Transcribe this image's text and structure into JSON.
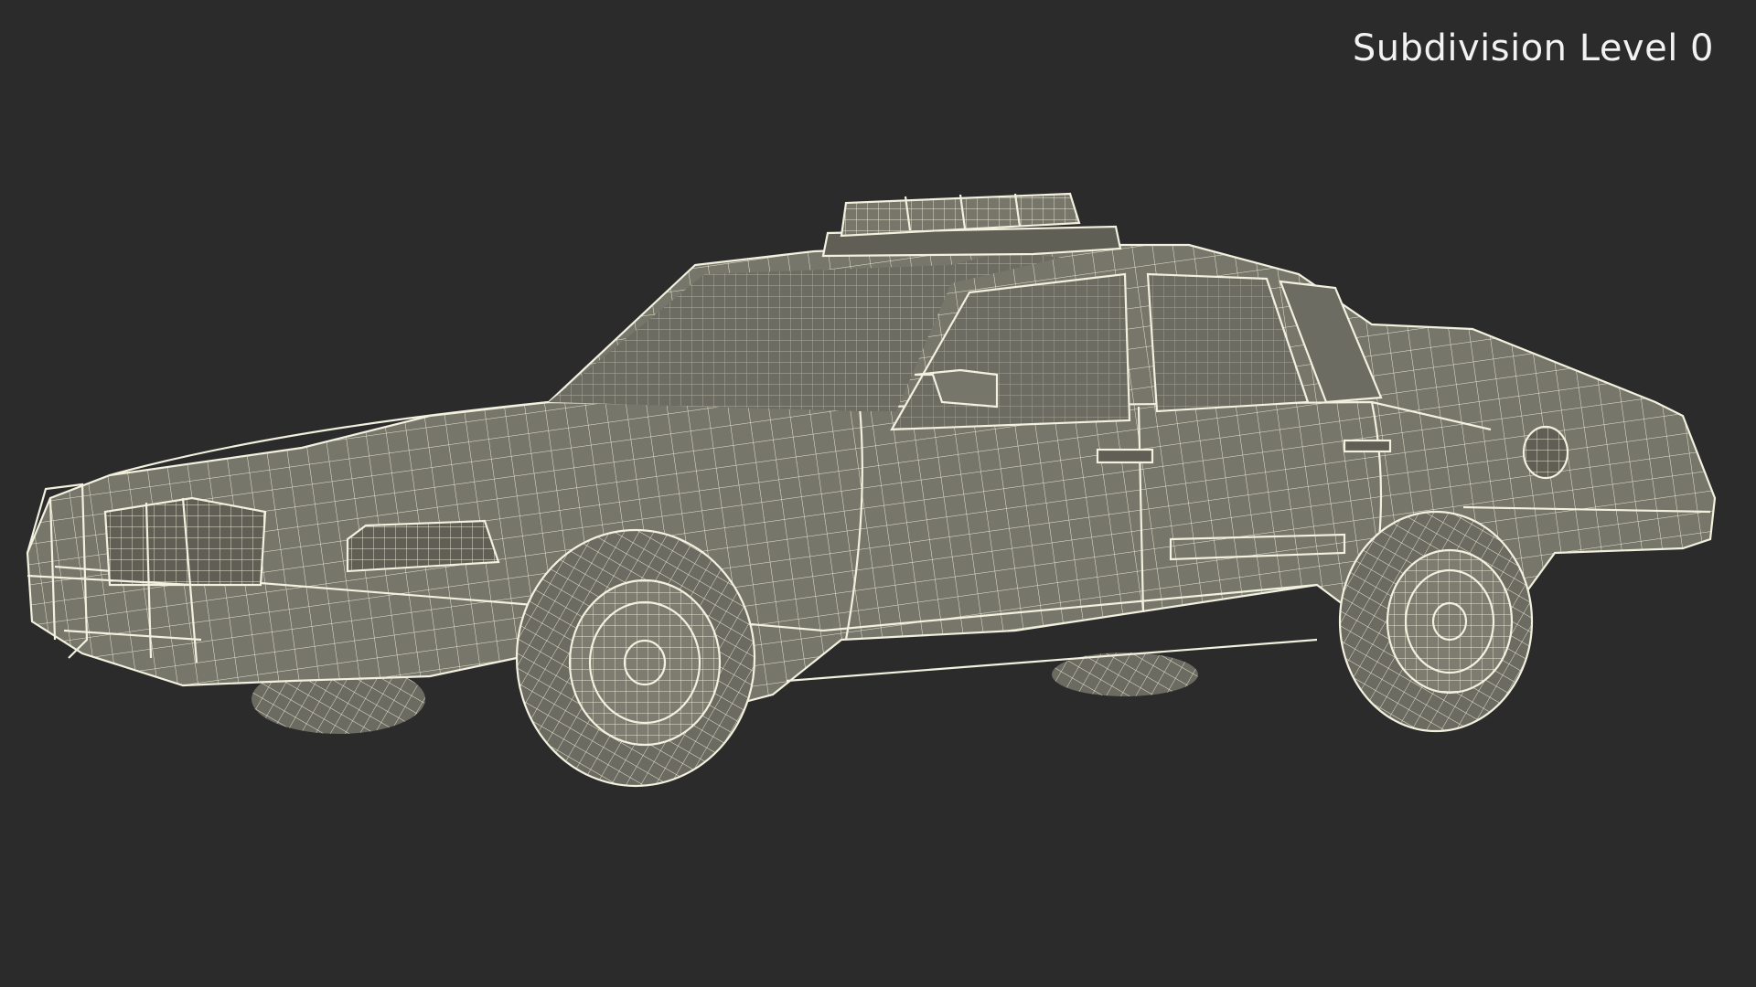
{
  "viewport": {
    "overlay_label": "Subdivision Level 0",
    "background_color": "#2b2b2b",
    "model_color": "#76766a",
    "wire_color": "#e9e7d4"
  },
  "model": {
    "subject": "police-sedan-wireframe"
  }
}
